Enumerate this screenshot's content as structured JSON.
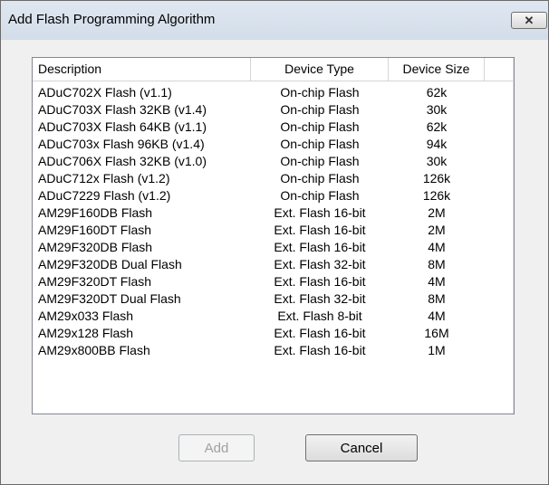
{
  "window": {
    "title": "Add Flash Programming Algorithm",
    "close_glyph": "✕"
  },
  "table": {
    "columns": [
      "Description",
      "Device Type",
      "Device Size"
    ],
    "rows": [
      [
        "ADuC702X Flash (v1.1)",
        "On-chip Flash",
        "62k"
      ],
      [
        "ADuC703X Flash 32KB (v1.4)",
        "On-chip Flash",
        "30k"
      ],
      [
        "ADuC703X Flash 64KB (v1.1)",
        "On-chip Flash",
        "62k"
      ],
      [
        "ADuC703x Flash 96KB (v1.4)",
        "On-chip Flash",
        "94k"
      ],
      [
        "ADuC706X Flash 32KB (v1.0)",
        "On-chip Flash",
        "30k"
      ],
      [
        "ADuC712x Flash (v1.2)",
        "On-chip Flash",
        "126k"
      ],
      [
        "ADuC7229 Flash (v1.2)",
        "On-chip Flash",
        "126k"
      ],
      [
        "AM29F160DB Flash",
        "Ext. Flash 16-bit",
        "2M"
      ],
      [
        "AM29F160DT Flash",
        "Ext. Flash 16-bit",
        "2M"
      ],
      [
        "AM29F320DB Flash",
        "Ext. Flash 16-bit",
        "4M"
      ],
      [
        "AM29F320DB Dual Flash",
        "Ext. Flash 32-bit",
        "8M"
      ],
      [
        "AM29F320DT Flash",
        "Ext. Flash 16-bit",
        "4M"
      ],
      [
        "AM29F320DT Dual Flash",
        "Ext. Flash 32-bit",
        "8M"
      ],
      [
        "AM29x033 Flash",
        "Ext. Flash 8-bit",
        "4M"
      ],
      [
        "AM29x128 Flash",
        "Ext. Flash 16-bit",
        "16M"
      ],
      [
        "AM29x800BB Flash",
        "Ext. Flash 16-bit",
        "1M"
      ]
    ]
  },
  "scrollbar": {
    "up_glyph": "▲",
    "down_glyph": "▼"
  },
  "buttons": {
    "add": "Add",
    "cancel": "Cancel"
  }
}
